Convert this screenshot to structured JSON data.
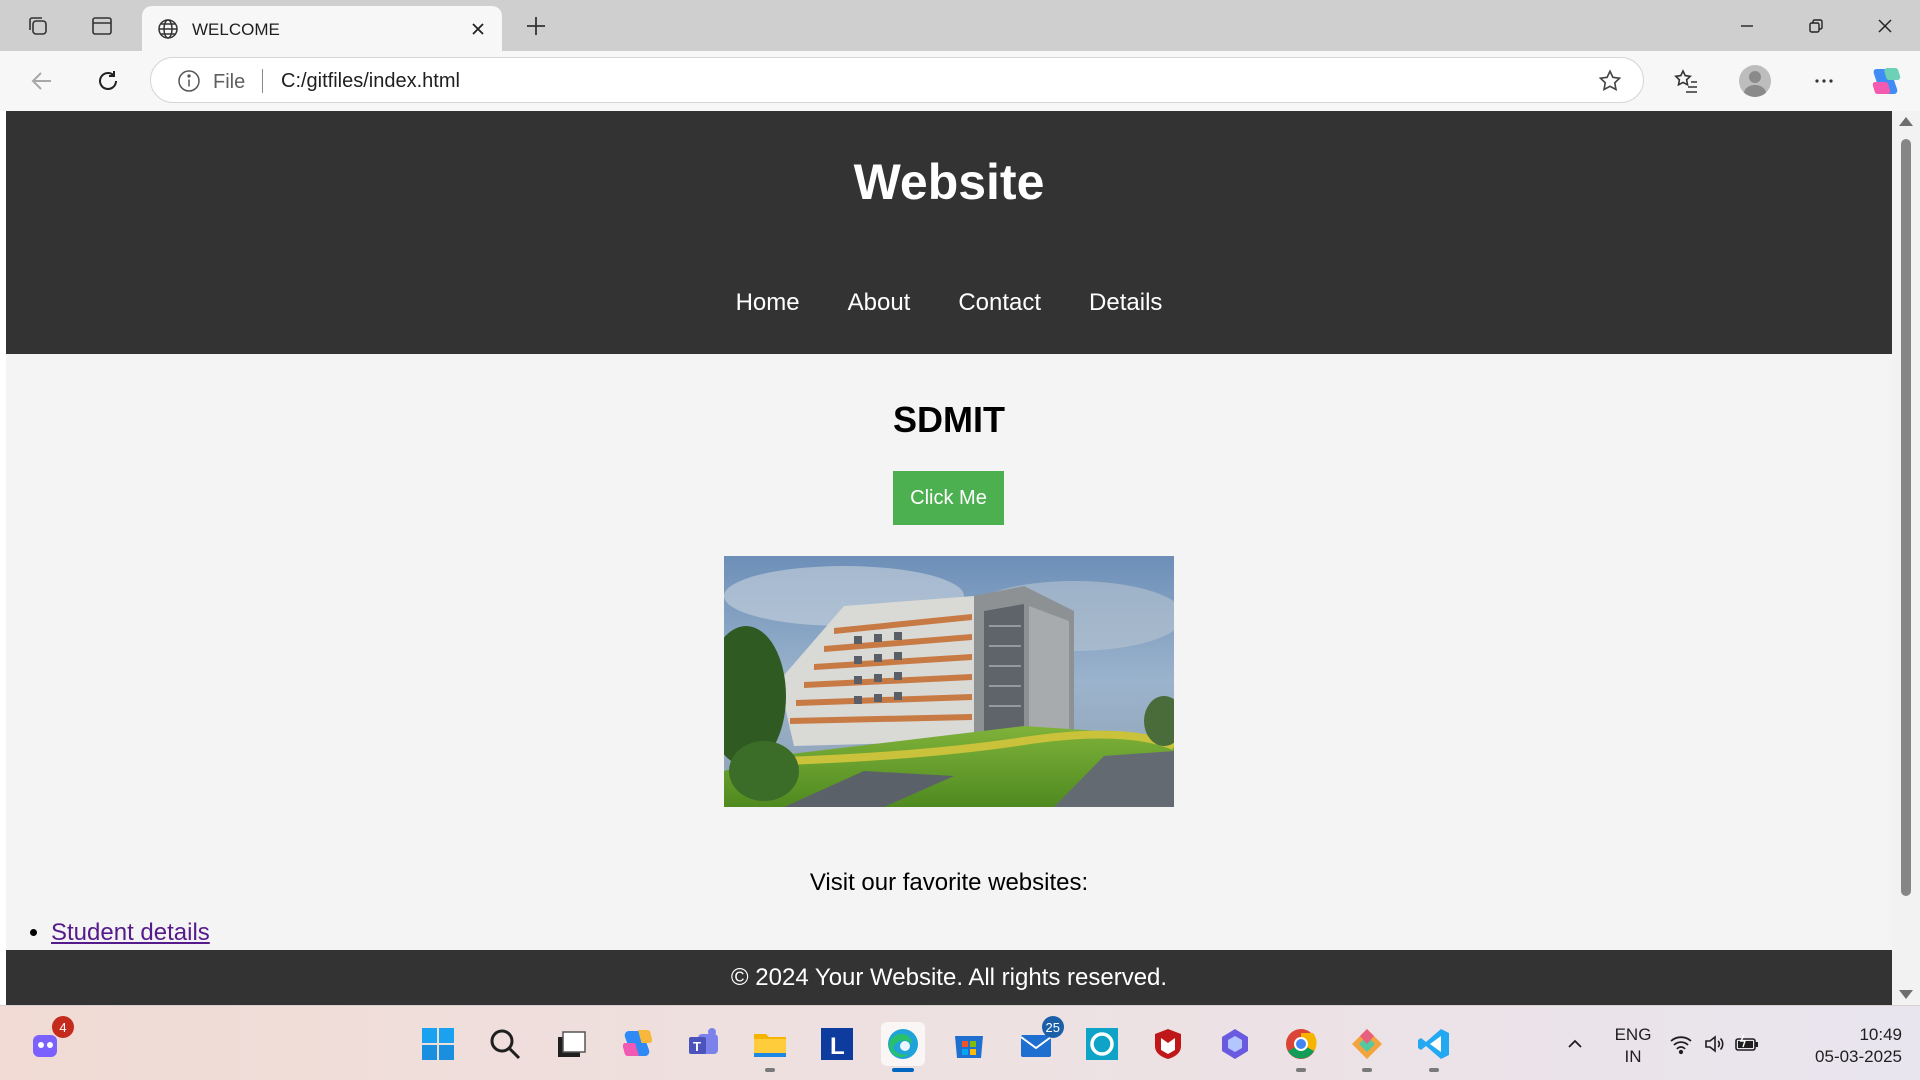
{
  "browser": {
    "tab_title": "WELCOME",
    "address_scheme": "File",
    "address_url": "C:/gitfiles/index.html"
  },
  "site": {
    "title": "Website",
    "nav": [
      "Home",
      "About",
      "Contact",
      "Details"
    ],
    "heading": "SDMIT",
    "button_label": "Click Me",
    "visit_text": "Visit our favorite websites:",
    "link_label": "Student details",
    "footer": "© 2024 Your Website. All rights reserved."
  },
  "taskbar": {
    "copilot_badge": "4",
    "mail_badge": "25",
    "lang_line1": "ENG",
    "lang_line2": "IN",
    "time": "10:49",
    "date": "05-03-2025"
  },
  "colors": {
    "header_bg": "#333333",
    "button_bg": "#4caf50",
    "page_bg": "#f4f4f4",
    "link": "#551a8b"
  }
}
